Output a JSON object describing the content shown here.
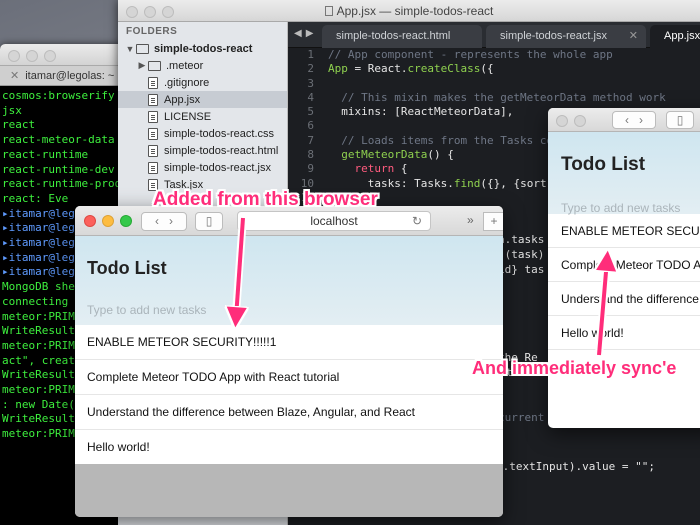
{
  "terminal": {
    "tab_title": "itamar@legolas: ~",
    "lines": [
      {
        "text": "cosmos:browserify",
        "color": "green"
      },
      {
        "text": "jsx",
        "color": "green"
      },
      {
        "text": "react",
        "color": "green"
      },
      {
        "text": "react-meteor-data",
        "color": "green"
      },
      {
        "text": "react-runtime",
        "color": "green"
      },
      {
        "text": "react-runtime-dev",
        "color": "green"
      },
      {
        "text": "react-runtime-prod",
        "color": "green"
      },
      {
        "text": "",
        "color": "green"
      },
      {
        "text": "",
        "color": "green"
      },
      {
        "text": "react: Eve",
        "color": "green"
      },
      {
        "text": "itamar@lego",
        "color": "blue"
      },
      {
        "text": "itamar@lego",
        "color": "blue"
      },
      {
        "text": "itamar@lego",
        "color": "blue"
      },
      {
        "text": "itamar@lego",
        "color": "blue"
      },
      {
        "text": "itamar@lego",
        "color": "blue"
      },
      {
        "text": "MongoDB she",
        "color": "green"
      },
      {
        "text": "connecting",
        "color": "green"
      },
      {
        "text": "meteor:PRIM",
        "color": "green"
      },
      {
        "text": "WriteResult",
        "color": "green"
      },
      {
        "text": "meteor:PRIM",
        "color": "green"
      },
      {
        "text": "act\", creat",
        "color": "green"
      },
      {
        "text": "WriteResult",
        "color": "green"
      },
      {
        "text": "meteor:PRIM",
        "color": "green"
      },
      {
        "text": ": new Date(",
        "color": "green"
      },
      {
        "text": "WriteResult",
        "color": "green"
      },
      {
        "text": "meteor:PRIM",
        "color": "green"
      }
    ]
  },
  "editor": {
    "window_title": "App.jsx — simple-todos-react",
    "sidebar": {
      "folders_label": "FOLDERS",
      "items": [
        {
          "label": "simple-todos-react",
          "type": "folder-open",
          "depth": 0,
          "bold": true
        },
        {
          "label": ".meteor",
          "type": "folder",
          "depth": 1
        },
        {
          "label": ".gitignore",
          "type": "file",
          "depth": 1
        },
        {
          "label": "App.jsx",
          "type": "file",
          "depth": 1,
          "selected": true
        },
        {
          "label": "LICENSE",
          "type": "file",
          "depth": 1
        },
        {
          "label": "simple-todos-react.css",
          "type": "file",
          "depth": 1
        },
        {
          "label": "simple-todos-react.html",
          "type": "file",
          "depth": 1
        },
        {
          "label": "simple-todos-react.jsx",
          "type": "file",
          "depth": 1
        },
        {
          "label": "Task.jsx",
          "type": "file",
          "depth": 1
        }
      ]
    },
    "tabs": [
      {
        "label": "simple-todos-react.html",
        "active": false
      },
      {
        "label": "simple-todos-react.jsx",
        "active": false
      },
      {
        "label": "App.jsx",
        "active": true
      }
    ],
    "code_lines": [
      {
        "n": "9",
        "html": "<span class=\"cm\">// App component - represents the whole app</span>"
      },
      {
        "n": "10",
        "html": "<span class=\"fn\">App</span> = React.<span class=\"fn\">createClass</span>({"
      },
      {
        "n": "3",
        "html": ""
      },
      {
        "n": "4",
        "html": "  <span class=\"cm\">// This mixin makes the getMeteorData method work</span>"
      },
      {
        "n": "5",
        "html": "  mixins: [ReactMeteorData],"
      },
      {
        "n": "6",
        "html": ""
      },
      {
        "n": "7",
        "html": "  <span class=\"cm\">// Loads items from the Tasks colle</span>"
      },
      {
        "n": "8",
        "html": "  <span class=\"fn\">getMeteorData</span>() {"
      },
      {
        "n": "9",
        "html": "    <span class=\"kw\">return</span> {"
      },
      {
        "n": "10",
        "html": "      tasks: Tasks.<span class=\"fn\">find</span>({}, {sort: {c"
      },
      {
        "n": "11",
        "html": "    }"
      },
      {
        "n": "12",
        "html": "  },"
      }
    ],
    "code_fragments": [
      {
        "text": "a.tasks"
      },
      {
        "text": "((task)"
      },
      {
        "text": "id} tas"
      },
      {
        "text": "the Re"
      },
      {
        "text": "this"
      },
      {
        "text": "current time"
      },
      {
        "text": "s.textInput).value = \"\";"
      }
    ]
  },
  "browser_main": {
    "url": "localhost",
    "title": "Todo List",
    "placeholder": "Type to add new tasks",
    "tasks": [
      "ENABLE METEOR SECURITY!!!!!1",
      "Complete Meteor TODO App with React tutorial",
      "Understand the difference between Blaze, Angular, and React",
      "Hello world!"
    ]
  },
  "browser_right": {
    "title": "Todo List",
    "placeholder": "Type to add new tasks",
    "tasks": [
      "ENABLE METEOR SECURI",
      "Complete Meteor TODO A",
      "Understand the difference",
      "Hello world!"
    ]
  },
  "annotations": {
    "added": "Added from this browser",
    "synced": "And immediately sync'e"
  },
  "colors": {
    "annotation": "#ff2d7a",
    "terminal_green": "#3ef03e",
    "terminal_blue": "#5f9bff",
    "header_bg": "#d8e9f1"
  }
}
